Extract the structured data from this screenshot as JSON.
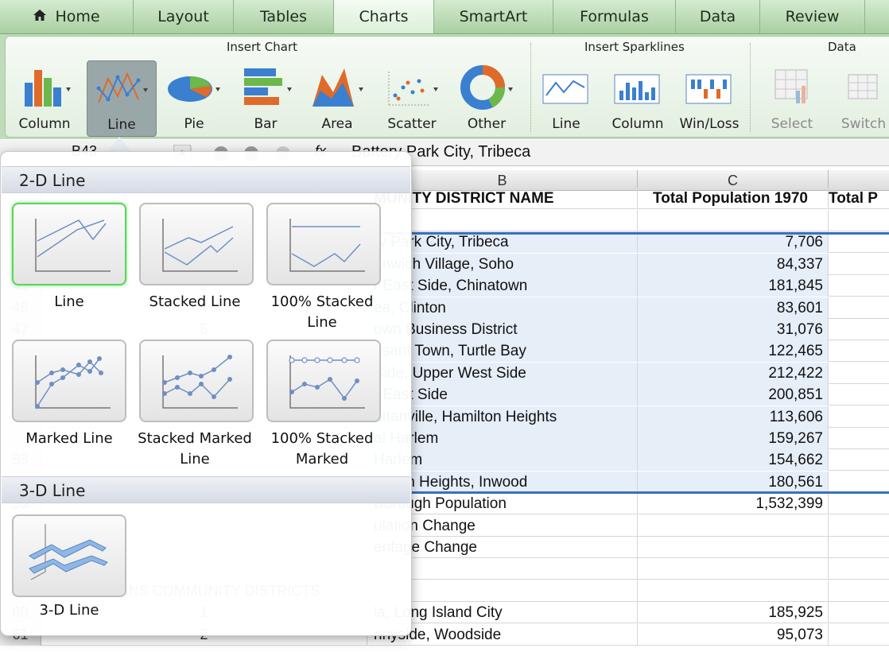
{
  "tabs": [
    "Home",
    "Layout",
    "Tables",
    "Charts",
    "SmartArt",
    "Formulas",
    "Data",
    "Review"
  ],
  "active_tab": "Charts",
  "ribbon": {
    "groups": [
      "Insert Chart",
      "Insert Sparklines",
      "Data"
    ],
    "chart_buttons": [
      "Column",
      "Line",
      "Pie",
      "Bar",
      "Area",
      "Scatter",
      "Other"
    ],
    "sparkline_buttons": [
      "Line",
      "Column",
      "Win/Loss"
    ],
    "data_buttons": [
      "Select",
      "Switch"
    ]
  },
  "formula_bar": {
    "name_box": "B43",
    "fx": "fx",
    "content": "Battery Park City, Tribeca"
  },
  "columns": [
    "B",
    "C"
  ],
  "header_row": {
    "b": "MUNITY DISTRICT NAME",
    "c": "Total Population 1970",
    "d": "Total P"
  },
  "rows": [
    {
      "n": "",
      "a": "",
      "b": "",
      "c": ""
    },
    {
      "n": "",
      "a": "",
      "b": "ry Park City, Tribeca",
      "c": "7,706"
    },
    {
      "n": "",
      "a": "",
      "b": "enwich Village, Soho",
      "c": "84,337"
    },
    {
      "n": "45",
      "a": "3",
      "b": "r East Side, Chinatown",
      "c": "181,845"
    },
    {
      "n": "46",
      "a": "4",
      "b": "ea, Clinton",
      "c": "83,601"
    },
    {
      "n": "47",
      "a": "5",
      "b": "own Business District",
      "c": "31,076"
    },
    {
      "n": "",
      "a": "",
      "b": "esant Town, Turtle Bay",
      "c": "122,465"
    },
    {
      "n": "",
      "a": "",
      "b": "Side, Upper West Side",
      "c": "212,422"
    },
    {
      "n": "",
      "a": "",
      "b": "r East Side",
      "c": "200,851"
    },
    {
      "n": "",
      "a": "",
      "b": "attanville, Hamilton Heights",
      "c": "113,606"
    },
    {
      "n": "",
      "a": "",
      "b": "al Harlem",
      "c": "159,267"
    },
    {
      "n": "53",
      "a": "",
      "b": "Harlem",
      "c": "154,662"
    },
    {
      "n": "",
      "a": "",
      "b": "ington Heights, Inwood",
      "c": "180,561"
    },
    {
      "n": "55",
      "a": "",
      "b": "Borough Population",
      "c": "1,532,399"
    },
    {
      "n": "",
      "a": "",
      "b": "ulation Change",
      "c": ""
    },
    {
      "n": "",
      "a": "",
      "b": "entage Change",
      "c": ""
    },
    {
      "n": "",
      "a": "",
      "b": "",
      "c": ""
    },
    {
      "n": "59",
      "a": "QUEENS COMMUNITY DISTRICTS",
      "b": "",
      "c": ""
    },
    {
      "n": "60",
      "a": "1",
      "b": "ia, Long Island City",
      "c": "185,925"
    },
    {
      "n": "61",
      "a": "2",
      "b": "nnyside, Woodside",
      "c": "95,073"
    }
  ],
  "popover": {
    "section_2d": "2-D Line",
    "section_3d": "3-D Line",
    "items_2d": [
      "Line",
      "Stacked Line",
      "100% Stacked Line",
      "Marked Line",
      "Stacked Marked Line",
      "100% Stacked Marked"
    ],
    "items_3d": [
      "3-D Line"
    ]
  }
}
